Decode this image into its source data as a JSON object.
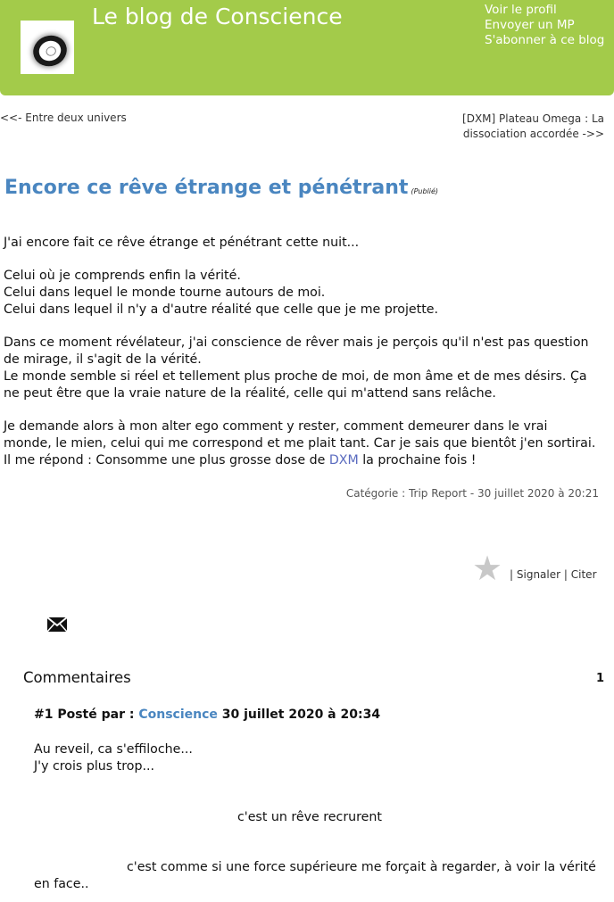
{
  "header": {
    "blog_title": "Le blog de Conscience",
    "links": [
      "Voir le profil",
      "Envoyer un MP",
      "S'abonner à ce blog"
    ],
    "background_color": "#a3cb4a"
  },
  "nav": {
    "prev": "<<- Entre deux univers",
    "next": "[DXM] Plateau Omega : La dissociation accordée ->>"
  },
  "post": {
    "title": "Encore ce rêve étrange et pénétrant",
    "status": "(Publié)",
    "paragraphs": [
      [
        "J'ai encore fait ce rêve étrange et pénétrant cette nuit..."
      ],
      [
        "Celui où je comprends enfin la vérité.",
        "Celui dans lequel le monde tourne autours de moi.",
        "Celui dans lequel il n'y a d'autre réalité que celle que je me projette."
      ],
      [
        "Dans ce moment révélateur, j'ai conscience de rêver mais je perçois qu'il n'est pas question de mirage, il s'agit de la vérité.",
        "Le monde semble si réel et tellement plus proche de moi, de mon âme et de mes désirs. Ça ne peut être que la vraie nature de la réalité, celle qui m'attend sans relâche."
      ],
      [
        "Je demande alors à mon alter ego comment y rester, comment demeurer dans le vrai monde, le mien, celui qui me correspond et me plait tant. Car je sais que bientôt j'en sortirai."
      ]
    ],
    "last_line_before": "Il me répond : Consomme une plus grosse dose de ",
    "last_line_link": "DXM",
    "last_line_after": " la prochaine fois !",
    "category": "Catégorie : Trip Report - 30 juillet 2020 à  20:21",
    "link_color": "#4a86c0"
  },
  "actions": {
    "star_icon": "star-icon",
    "signaler": "Signaler",
    "citer": "Citer",
    "separator": "|"
  },
  "comments": {
    "title": "Commentaires",
    "count": "1",
    "items": [
      {
        "number": "#1 Posté par :",
        "author": "Conscience",
        "date": "30 juillet 2020 à  20:34",
        "lines": [
          "Au reveil, ca s'effiloche...",
          "J'y crois plus trop..."
        ],
        "centered": "c'est un rêve recrurent",
        "long": "c'est comme si une force supérieure me forçait à regarder, à voir la vérité en face.."
      }
    ]
  }
}
